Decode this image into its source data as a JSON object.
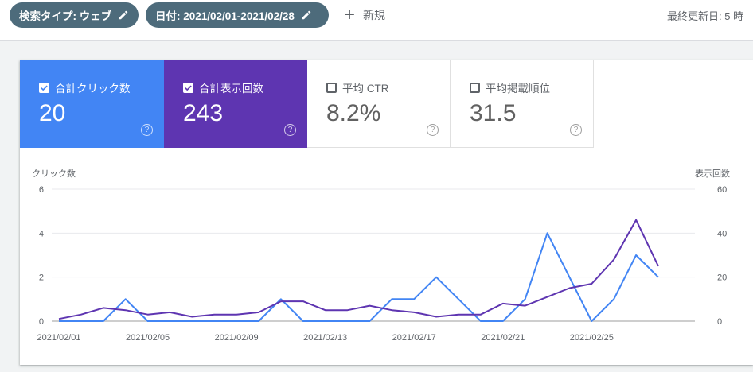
{
  "filters": {
    "search_type": "検索タイプ: ウェブ",
    "date": "日付: 2021/02/01-2021/02/28",
    "new_label": "新規"
  },
  "last_updated": "最終更新日: 5 時",
  "metrics": [
    {
      "label": "合計クリック数",
      "value": "20",
      "checked": true,
      "color": "#4285f4"
    },
    {
      "label": "合計表示回数",
      "value": "243",
      "checked": true,
      "color": "#5e35b1"
    },
    {
      "label": "平均 CTR",
      "value": "8.2%",
      "checked": false
    },
    {
      "label": "平均掲載順位",
      "value": "31.5",
      "checked": false
    }
  ],
  "help_glyph": "?",
  "chart_data": {
    "type": "line",
    "ylabel_left": "クリック数",
    "ylabel_right": "表示回数",
    "y_left_ticks": [
      "0",
      "2",
      "4",
      "6"
    ],
    "y_right_ticks": [
      "0",
      "20",
      "40",
      "60"
    ],
    "ylim_left": [
      0,
      6
    ],
    "ylim_right": [
      0,
      60
    ],
    "x_tick_labels": [
      "2021/02/01",
      "2021/02/05",
      "2021/02/09",
      "2021/02/13",
      "2021/02/17",
      "2021/02/21",
      "2021/02/25"
    ],
    "x": [
      "2021/02/01",
      "2021/02/02",
      "2021/02/03",
      "2021/02/04",
      "2021/02/05",
      "2021/02/06",
      "2021/02/07",
      "2021/02/08",
      "2021/02/09",
      "2021/02/10",
      "2021/02/11",
      "2021/02/12",
      "2021/02/13",
      "2021/02/14",
      "2021/02/15",
      "2021/02/16",
      "2021/02/17",
      "2021/02/18",
      "2021/02/19",
      "2021/02/20",
      "2021/02/21",
      "2021/02/22",
      "2021/02/23",
      "2021/02/24",
      "2021/02/25",
      "2021/02/26",
      "2021/02/27",
      "2021/02/28"
    ],
    "grid": true,
    "series": [
      {
        "name": "クリック数",
        "axis": "left",
        "color": "#4285f4",
        "values": [
          0,
          0,
          0,
          1,
          0,
          0,
          0,
          0,
          0,
          0,
          1,
          0,
          0,
          0,
          0,
          1,
          1,
          2,
          1,
          0,
          0,
          1,
          4,
          2,
          0,
          1,
          3,
          2
        ]
      },
      {
        "name": "表示回数",
        "axis": "right",
        "color": "#5e35b1",
        "values": [
          1,
          3,
          6,
          5,
          3,
          4,
          2,
          3,
          3,
          4,
          9,
          9,
          5,
          5,
          7,
          5,
          4,
          2,
          3,
          3,
          8,
          7,
          11,
          15,
          17,
          28,
          46,
          25
        ]
      }
    ]
  }
}
